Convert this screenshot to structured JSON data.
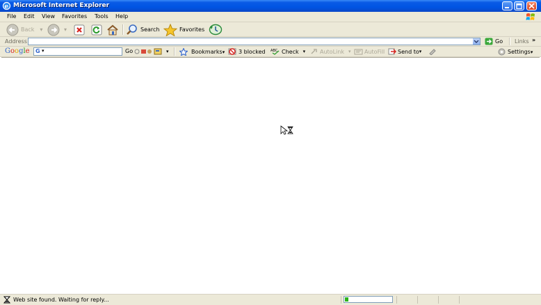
{
  "window": {
    "title": "Microsoft Internet Explorer"
  },
  "menu": {
    "items": [
      "File",
      "Edit",
      "View",
      "Favorites",
      "Tools",
      "Help"
    ]
  },
  "toolbar": {
    "back_label": "Back",
    "search_label": "Search",
    "favorites_label": "Favorites"
  },
  "address": {
    "label": "Address",
    "value": "",
    "go_label": "Go",
    "links_label": "Links"
  },
  "google": {
    "logo": "Google",
    "search_value": "",
    "go_label": "Go",
    "bookmarks_label": "Bookmarks",
    "blocked_label": "3 blocked",
    "check_label": "Check",
    "autolink_label": "AutoLink",
    "autofill_label": "AutoFill",
    "sendto_label": "Send to",
    "settings_label": "Settings"
  },
  "status": {
    "text": "Web site found. Waiting for reply...",
    "progress": 0.08
  },
  "colors": {
    "title_bar": "#0054e3",
    "chrome": "#ece9d8",
    "progress": "#2bb31b"
  }
}
